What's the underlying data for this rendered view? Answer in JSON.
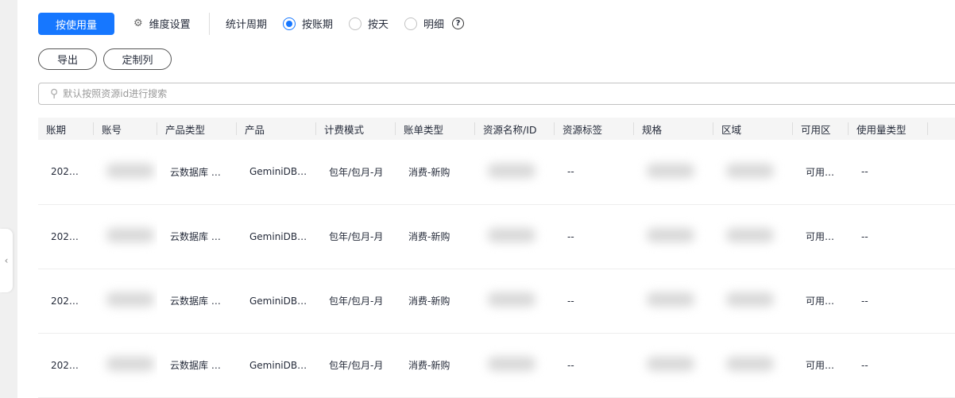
{
  "toolbar": {
    "usage_button": "按使用量",
    "dimension_settings": "维度设置",
    "period_label": "统计周期",
    "period_options": [
      {
        "label": "按账期",
        "selected": true
      },
      {
        "label": "按天",
        "selected": false
      },
      {
        "label": "明细",
        "selected": false
      }
    ],
    "help": "?"
  },
  "actions": {
    "export": "导出",
    "customize_columns": "定制列"
  },
  "search": {
    "placeholder": "默认按照资源id进行搜索",
    "value": ""
  },
  "table": {
    "columns": [
      "账期",
      "账号",
      "产品类型",
      "产品",
      "计费模式",
      "账单类型",
      "资源名称/ID",
      "资源标签",
      "规格",
      "区域",
      "可用区",
      "使用量类型"
    ],
    "rows": [
      [
        "202…",
        "",
        "云数据库 …",
        "GeminiDB…",
        "包年/包月-月",
        "消费-新购",
        "",
        "--",
        "",
        "",
        "可用…",
        "--"
      ],
      [
        "202…",
        "",
        "云数据库 …",
        "GeminiDB…",
        "包年/包月-月",
        "消费-新购",
        "",
        "--",
        "",
        "",
        "可用…",
        "--"
      ],
      [
        "202…",
        "",
        "云数据库 …",
        "GeminiDB…",
        "包年/包月-月",
        "消费-新购",
        "",
        "--",
        "",
        "",
        "可用…",
        "--"
      ],
      [
        "202…",
        "",
        "云数据库 …",
        "GeminiDB…",
        "包年/包月-月",
        "消费-新购",
        "",
        "--",
        "",
        "",
        "可用…",
        "--"
      ]
    ]
  },
  "colors": {
    "accent": "#1677ff"
  }
}
